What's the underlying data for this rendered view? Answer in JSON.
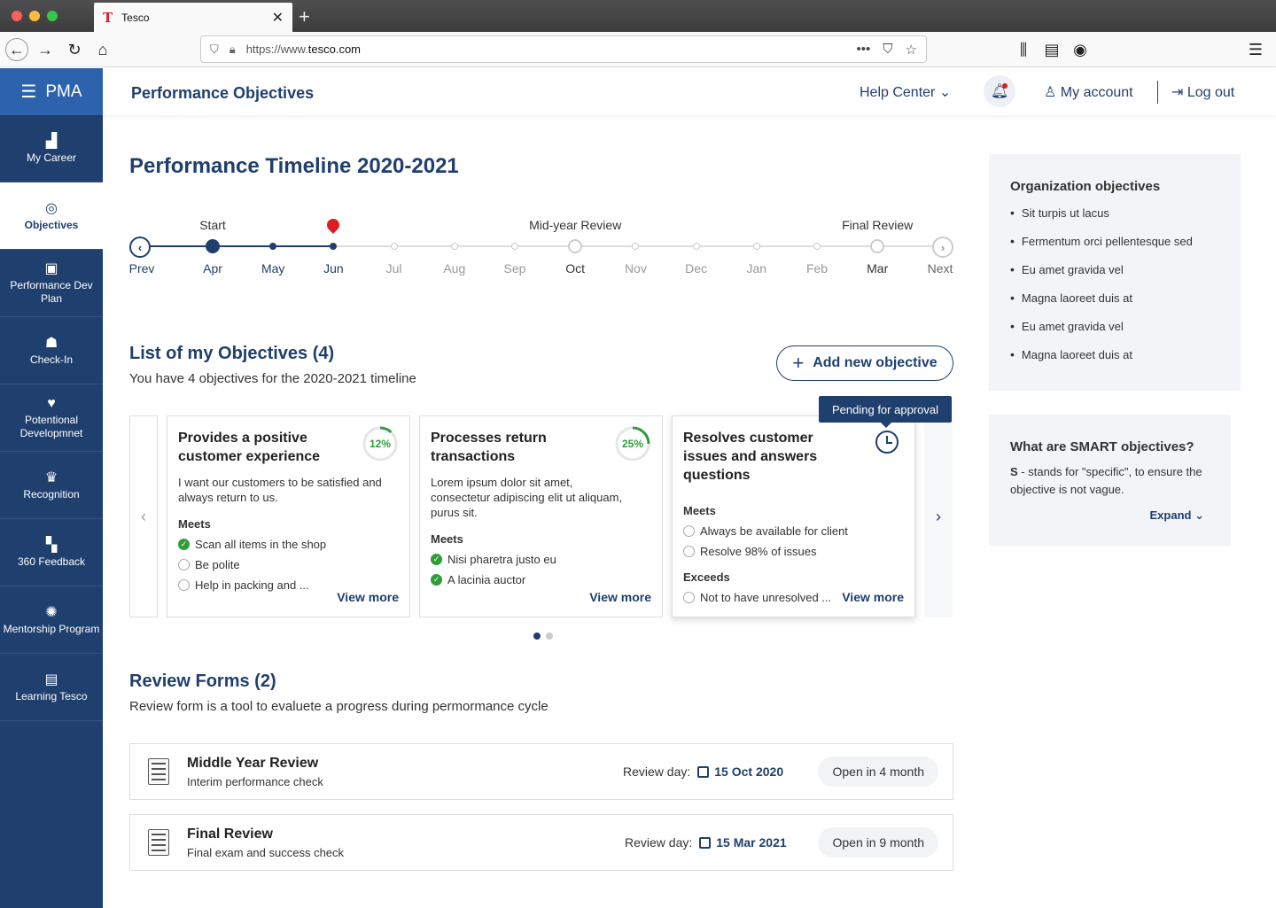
{
  "browser": {
    "tab_title": "Tesco",
    "tab_logo": "T",
    "url_scheme": "https://www.",
    "url_host": "tesco",
    "url_tld": ".com"
  },
  "sidebar": {
    "brand": "PMA",
    "items": [
      {
        "label": "My Career",
        "icon": "bar-chart-icon",
        "glyph": "▟"
      },
      {
        "label": "Objectives",
        "icon": "target-icon",
        "glyph": "◎"
      },
      {
        "label": "Performance Dev Plan",
        "icon": "clipboard-icon",
        "glyph": "▣"
      },
      {
        "label": "Check-In",
        "icon": "meeting-icon",
        "glyph": "☗"
      },
      {
        "label": "Potentional Developmnet",
        "icon": "growth-icon",
        "glyph": "♥"
      },
      {
        "label": "Recognition",
        "icon": "trophy-icon",
        "glyph": "♛"
      },
      {
        "label": "360 Feedback",
        "icon": "feedback-icon",
        "glyph": "▚"
      },
      {
        "label": "Mentorship Program",
        "icon": "mentor-icon",
        "glyph": "✺"
      },
      {
        "label": "Learning Tesco",
        "icon": "book-icon",
        "glyph": "▤"
      }
    ]
  },
  "header": {
    "title": "Performance Objectives",
    "help": "Help Center",
    "account": "My account",
    "logout": "Log out"
  },
  "timeline": {
    "title": "Performance Timeline 2020-2021",
    "prev": "Prev",
    "next": "Next",
    "milestones": {
      "start": "Start",
      "mid": "Mid-year Review",
      "final": "Final Review"
    },
    "months": [
      "Apr",
      "May",
      "Jun",
      "Jul",
      "Aug",
      "Sep",
      "Oct",
      "Nov",
      "Dec",
      "Jan",
      "Feb",
      "Mar"
    ],
    "current_month_index": 2
  },
  "objectives": {
    "title": "List of my Objectives (4)",
    "subtitle": "You have 4 objectives for the 2020-2021 timeline",
    "add_label": "Add new objective",
    "tooltip": "Pending for approval",
    "view_more": "View more",
    "cards": [
      {
        "title": "Provides a positive customer experience",
        "desc": "I want our customers to be satisfied and always return to us.",
        "progress": "12%",
        "progress_value": 0.12,
        "sections": [
          {
            "label": "Meets",
            "items": [
              {
                "text": "Scan all items in the shop",
                "done": true
              },
              {
                "text": "Be polite",
                "done": false
              },
              {
                "text": "Help in packing and ...",
                "done": false
              }
            ]
          }
        ]
      },
      {
        "title": "Processes return transactions",
        "desc": "Lorem ipsum dolor sit amet, consectetur adipiscing elit ut aliquam, purus sit.",
        "progress": "25%",
        "progress_value": 0.25,
        "sections": [
          {
            "label": "Meets",
            "items": [
              {
                "text": "Nisi pharetra justo eu",
                "done": true
              },
              {
                "text": "A lacinia auctor",
                "done": true
              }
            ]
          }
        ]
      },
      {
        "title": "Resolves customer issues and answers questions",
        "desc": "",
        "status": "pending",
        "sections": [
          {
            "label": "Meets",
            "items": [
              {
                "text": "Always be available for client",
                "done": false
              },
              {
                "text": "Resolve 98% of issues",
                "done": false
              }
            ]
          },
          {
            "label": "Exceeds",
            "items": [
              {
                "text": "Not to have unresolved ...",
                "done": false
              }
            ]
          }
        ]
      }
    ]
  },
  "reviews": {
    "title": "Review Forms (2)",
    "subtitle": "Review form is a tool to evaluete a progress during permormance cycle",
    "day_label": "Review day:",
    "items": [
      {
        "title": "Middle Year Review",
        "sub": "Interim performance check",
        "date": "15 Oct 2020",
        "badge": "Open in 4 month"
      },
      {
        "title": "Final Review",
        "sub": "Final exam and success check",
        "date": "15 Mar 2021",
        "badge": "Open in 9 month"
      }
    ]
  },
  "org": {
    "title": "Organization objectives",
    "items": [
      "Sit turpis ut lacus",
      "Fermentum orci pellentesque sed",
      "Eu amet gravida vel",
      "Magna laoreet duis at",
      "Eu amet gravida vel",
      "Magna laoreet duis at"
    ]
  },
  "smart": {
    "title": "What are SMART objectives?",
    "letter": "S",
    "text": " - stands for \"specific\", to ensure the objective is not vague.",
    "expand": "Expand"
  },
  "colors": {
    "primary": "#1f3f6e",
    "accent": "#2d63ad",
    "success": "#2e9e38",
    "alert": "#e11b22"
  }
}
